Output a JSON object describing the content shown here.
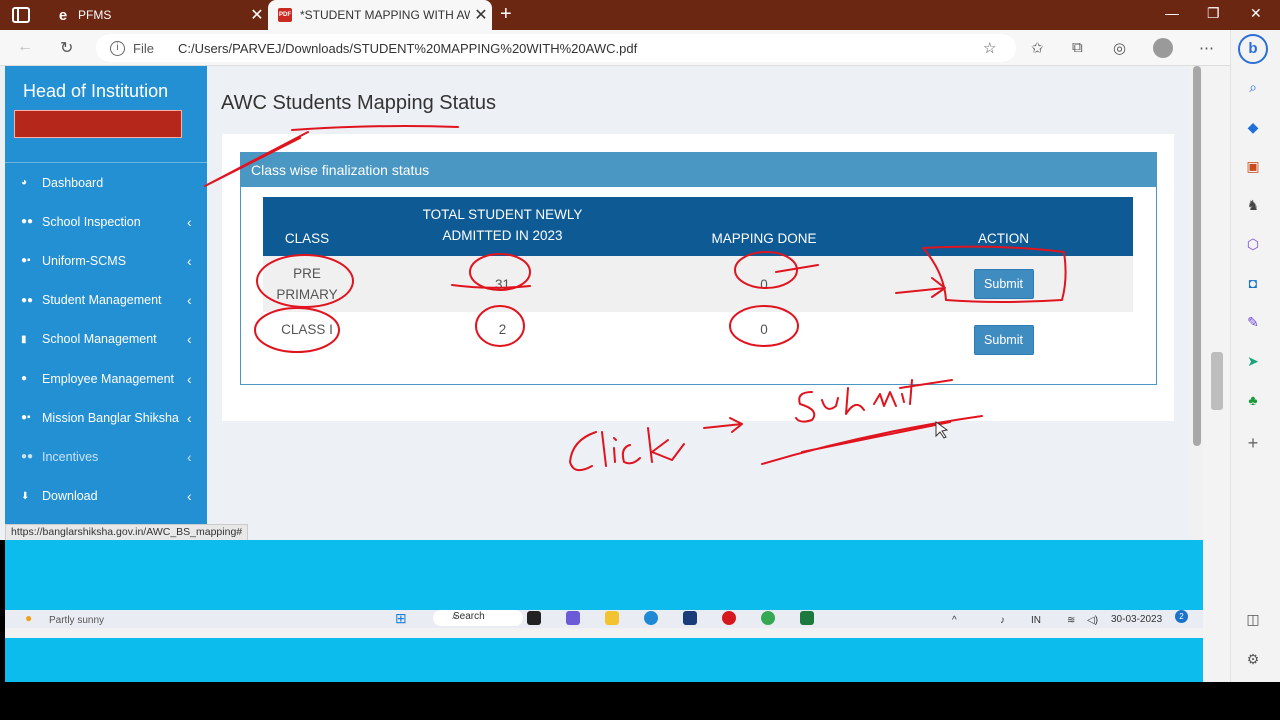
{
  "browser": {
    "tabs": [
      {
        "title": "PFMS",
        "favicon": "e",
        "active": false
      },
      {
        "title": "*STUDENT MAPPING WITH AWC",
        "favicon": "PDF",
        "active": true
      }
    ],
    "address_scheme": "File",
    "address_url": "C:/Users/PARVEJ/Downloads/STUDENT%20MAPPING%20WITH%20AWC.pdf",
    "status_url": "https://banglarshiksha.gov.in/AWC_BS_mapping#"
  },
  "sidebar": {
    "heading": "Head of Institution",
    "items": [
      {
        "label": "Dashboard",
        "icon": "dashboard-icon",
        "chevron": false
      },
      {
        "label": "School Inspection",
        "icon": "users-icon",
        "chevron": true
      },
      {
        "label": "Uniform-SCMS",
        "icon": "user-tie-icon",
        "chevron": true
      },
      {
        "label": "Student Management",
        "icon": "users-icon",
        "chevron": true
      },
      {
        "label": "School Management",
        "icon": "book-icon",
        "chevron": true
      },
      {
        "label": "Employee Management",
        "icon": "user-icon",
        "chevron": true
      },
      {
        "label": "Mission Banglar Shiksha",
        "icon": "user-tie-icon",
        "chevron": true
      },
      {
        "label": "Incentives",
        "icon": "users-icon",
        "chevron": true
      },
      {
        "label": "Download",
        "icon": "download-icon",
        "chevron": true
      }
    ]
  },
  "main": {
    "title": "AWC Students Mapping Status",
    "panel_title": "Class wise finalization status",
    "table": {
      "headers": [
        "CLASS",
        "TOTAL STUDENT NEWLY ADMITTED IN 2023",
        "MAPPING DONE",
        "ACTION"
      ],
      "rows": [
        {
          "class": "PRE PRIMARY",
          "total": "31",
          "mapped": "0",
          "action": "Submit"
        },
        {
          "class": "CLASS I",
          "total": "2",
          "mapped": "0",
          "action": "Submit"
        }
      ]
    }
  },
  "annotations": {
    "click_word": "Click",
    "submit_word": "Submit"
  },
  "taskbar": {
    "weather": "Partly sunny",
    "search": "Search",
    "lang": "IN",
    "date": "30-03-2023",
    "badge": "2"
  },
  "colors": {
    "tab_bar": "#6b2712",
    "sidebar": "#2490d4",
    "table_header": "#0d5a95",
    "panel_header": "#4a97c4",
    "submit_button": "#3f8cc1",
    "ink": "#e0141e",
    "cyan_region": "#0bbcec"
  }
}
